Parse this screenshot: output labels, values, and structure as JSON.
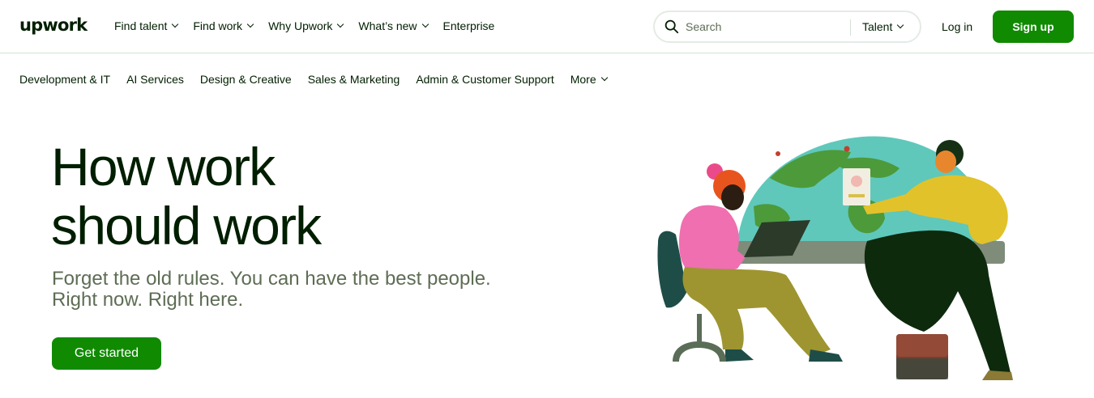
{
  "brand": {
    "logo_text": "upwork"
  },
  "topnav": {
    "items": [
      {
        "label": "Find talent",
        "has_dropdown": true
      },
      {
        "label": "Find work",
        "has_dropdown": true
      },
      {
        "label": "Why Upwork",
        "has_dropdown": true
      },
      {
        "label": "What’s new",
        "has_dropdown": true
      },
      {
        "label": "Enterprise",
        "has_dropdown": false
      }
    ]
  },
  "search": {
    "placeholder": "Search",
    "category": "Talent"
  },
  "auth": {
    "login_label": "Log in",
    "signup_label": "Sign up"
  },
  "categories": [
    {
      "label": "Development & IT"
    },
    {
      "label": "AI Services"
    },
    {
      "label": "Design & Creative"
    },
    {
      "label": "Sales & Marketing"
    },
    {
      "label": "Admin & Customer Support"
    },
    {
      "label": "More",
      "has_dropdown": true
    }
  ],
  "hero": {
    "title_line1": "How work",
    "title_line2": "should work",
    "subtitle_line1": "Forget the old rules. You can have the best people.",
    "subtitle_line2": "Right now. Right here.",
    "cta_label": "Get started"
  },
  "colors": {
    "brand_green": "#108a00",
    "text_dark": "#001e00",
    "text_muted": "#5e6d55",
    "border": "#d5e0d5"
  },
  "icons": [
    "search-icon",
    "chevron-down-icon"
  ]
}
